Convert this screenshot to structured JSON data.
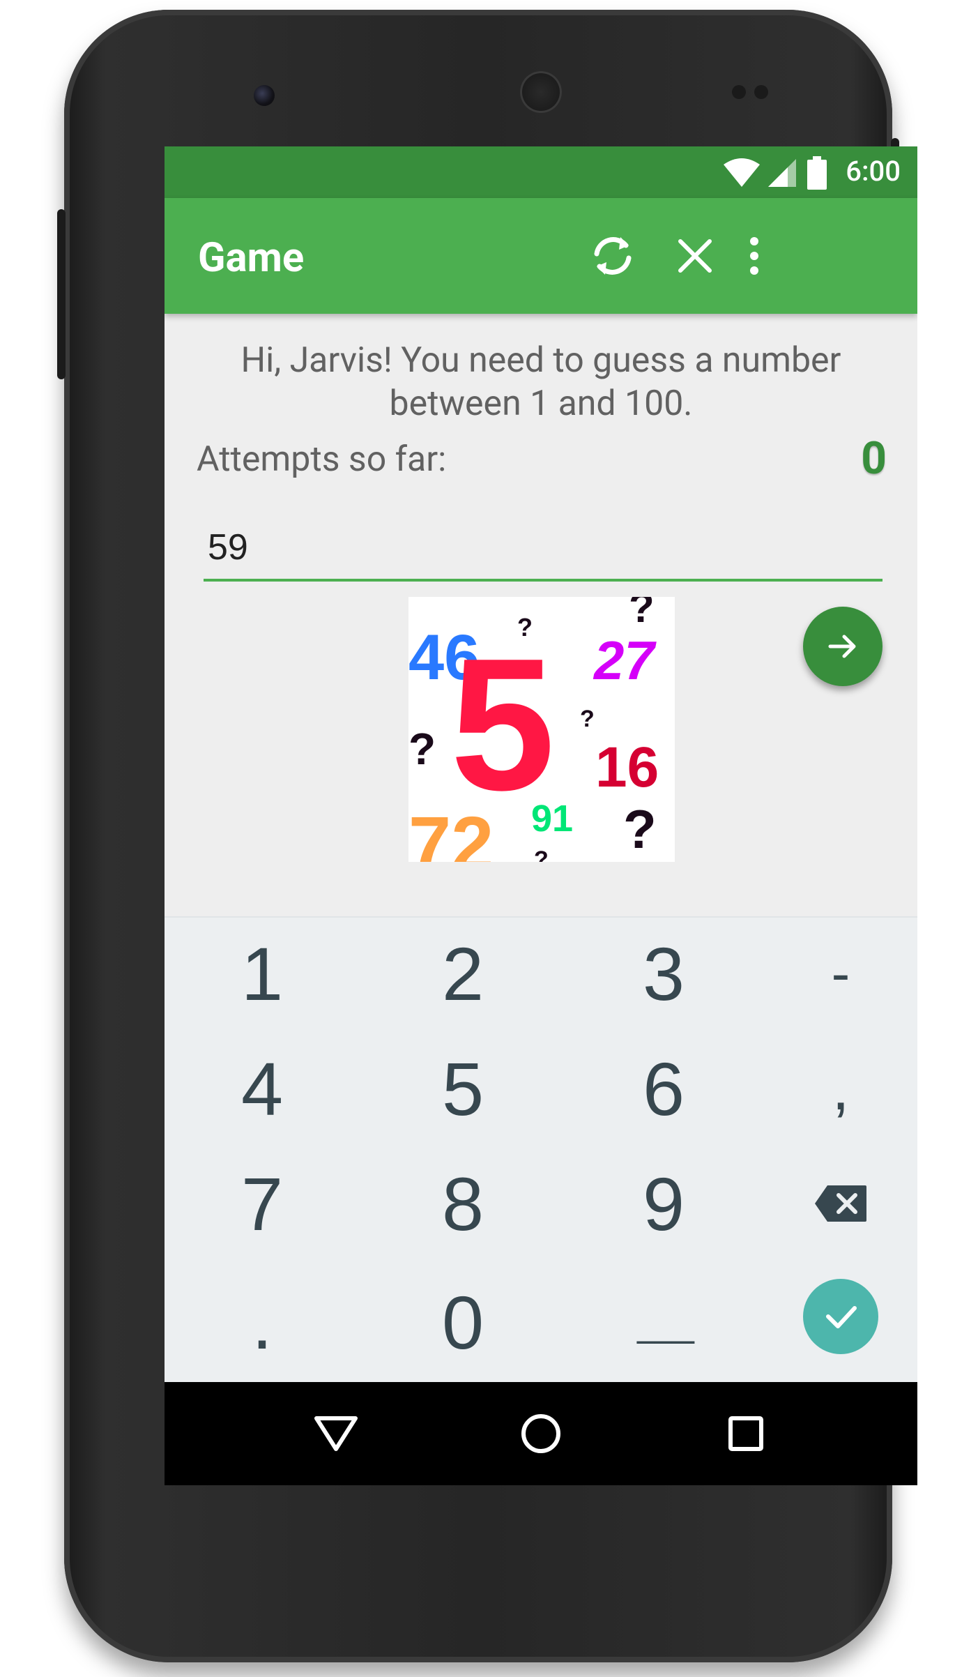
{
  "status_bar": {
    "time": "6:00"
  },
  "app_bar": {
    "title": "Game",
    "actions": [
      "refresh-icon",
      "close-icon",
      "more-vert-icon"
    ]
  },
  "game": {
    "greeting": "Hi, Jarvis! You need to guess a number between 1 and 100.",
    "attempts_label": "Attempts so far:",
    "attempts_value": "0",
    "guess_value": "59"
  },
  "image_numbers": {
    "n46": "46",
    "n27": "27",
    "n5": "5",
    "n16": "16",
    "n72": "72",
    "n91": "91",
    "q": "?"
  },
  "keypad": {
    "k1": "1",
    "k2": "2",
    "k3": "3",
    "minus": "-",
    "k4": "4",
    "k5": "5",
    "k6": "6",
    "comma": ",",
    "k7": "7",
    "k8": "8",
    "k9": "9",
    "period": ".",
    "k0": "0",
    "space": "___"
  },
  "colors": {
    "primary": "#4caf50",
    "primary_dark": "#388e3c",
    "accent_done": "#4db6ac",
    "keypad_bg": "#eceff1"
  },
  "nav_bar": [
    "back-icon",
    "home-icon",
    "recents-icon"
  ]
}
